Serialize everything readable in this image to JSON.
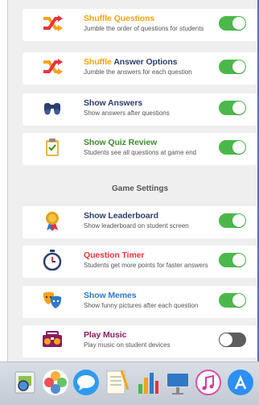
{
  "settings": [
    {
      "title_pre": "Shuffle",
      "title_post": " Questions",
      "pre_color": "orange",
      "post_color": "orange",
      "desc": "Jumble the order of questions for students",
      "icon": "shuffle-icon",
      "toggle": true
    },
    {
      "title_pre": "Shuffle",
      "title_post": " Answer Options",
      "pre_color": "orange",
      "post_color": "navy",
      "desc": "Jumble the answers for each question",
      "icon": "shuffle-icon",
      "toggle": true
    },
    {
      "title_pre": "Show Answers",
      "title_post": "",
      "pre_color": "navy",
      "post_color": "navy",
      "desc": "Show answers after questions",
      "icon": "binoculars-icon",
      "toggle": true
    },
    {
      "title_pre": "Show Quiz Review",
      "title_post": "",
      "pre_color": "green",
      "post_color": "green",
      "desc": "Students see all questions at game end",
      "icon": "clipboard-icon",
      "toggle": true
    }
  ],
  "section_title": "Game Settings",
  "game_settings": [
    {
      "title": "Show Leaderboard",
      "color": "navy",
      "desc": "Show leaderboard on student screen",
      "icon": "medal-icon",
      "toggle": true
    },
    {
      "title": "Question Timer",
      "color": "red",
      "desc": "Students get more points for faster answers",
      "icon": "stopwatch-icon",
      "toggle": true
    },
    {
      "title": "Show Memes",
      "color": "blue",
      "desc": "Show funny pictures after each question",
      "icon": "theater-masks-icon",
      "toggle": true
    },
    {
      "title": "Play Music",
      "color": "purple",
      "desc": "Play music on student devices",
      "icon": "boombox-icon",
      "toggle": false
    }
  ],
  "dock": [
    "preview-icon",
    "photos-icon",
    "messages-icon",
    "textedit-icon",
    "numbers-icon",
    "keynote-icon",
    "itunes-icon",
    "app-store-icon"
  ],
  "colors": {
    "toggle_on": "#4bb84b",
    "toggle_off": "#5e5e5e",
    "accent": "#2b7de9"
  }
}
